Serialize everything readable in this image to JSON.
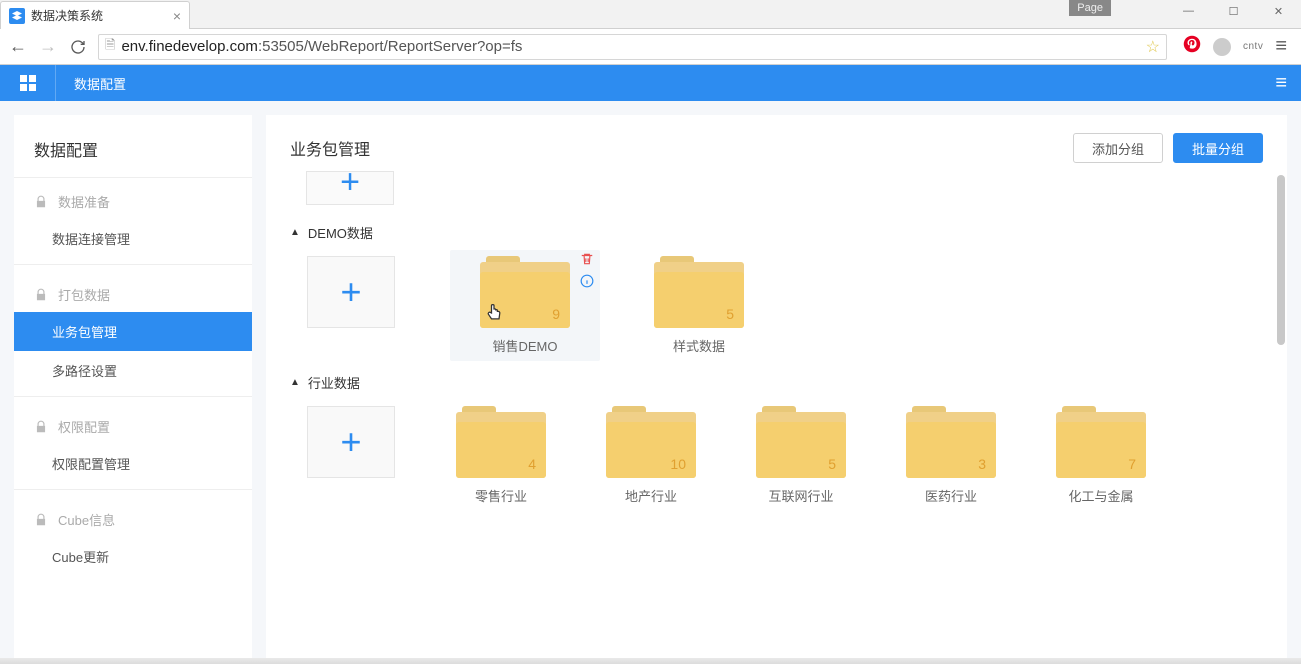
{
  "browser": {
    "tab_title": "数据决策系统",
    "page_label": "Page",
    "url_host": "env.finedevelop.com",
    "url_port": ":53505",
    "url_path": "/WebReport/ReportServer?op=fs",
    "ext_label": "cntv"
  },
  "header": {
    "section": "数据配置"
  },
  "sidebar": {
    "title": "数据配置",
    "groups": [
      {
        "label": "数据准备",
        "items": [
          {
            "label": "数据连接管理",
            "active": false
          }
        ]
      },
      {
        "label": "打包数据",
        "items": [
          {
            "label": "业务包管理",
            "active": true
          },
          {
            "label": "多路径设置",
            "active": false
          }
        ]
      },
      {
        "label": "权限配置",
        "items": [
          {
            "label": "权限配置管理",
            "active": false
          }
        ]
      },
      {
        "label": "Cube信息",
        "items": [
          {
            "label": "Cube更新",
            "active": false
          }
        ]
      }
    ]
  },
  "content": {
    "title": "业务包管理",
    "btn_add_group": "添加分组",
    "btn_batch_group": "批量分组",
    "groups": [
      {
        "name": "DEMO数据",
        "folders": [
          {
            "label": "销售DEMO",
            "count": "9",
            "selected": true
          },
          {
            "label": "样式数据",
            "count": "5",
            "selected": false
          }
        ]
      },
      {
        "name": "行业数据",
        "folders": [
          {
            "label": "零售行业",
            "count": "4"
          },
          {
            "label": "地产行业",
            "count": "10"
          },
          {
            "label": "互联网行业",
            "count": "5"
          },
          {
            "label": "医药行业",
            "count": "3"
          },
          {
            "label": "化工与金属",
            "count": "7"
          }
        ]
      }
    ]
  }
}
